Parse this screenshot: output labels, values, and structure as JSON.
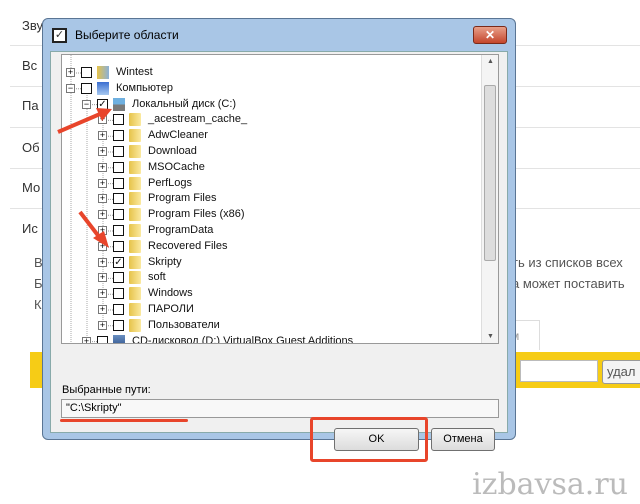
{
  "background": {
    "items": [
      "Зву",
      "Вс",
      "Па",
      "Об",
      "Мо",
      "Ис"
    ],
    "texts": [
      "В",
      "Б",
      "К",
      "ть из списков всех",
      "а может поставить"
    ],
    "tab_label": "м",
    "delete_button": "удал",
    "watermark": "izbavsa.ru"
  },
  "dialog": {
    "title": "Выберите области",
    "close_label": "✕",
    "tree": [
      {
        "label": "Wintest",
        "level": 0,
        "checked": false,
        "icon": "user-folder"
      },
      {
        "label": "Компьютер",
        "level": 0,
        "checked": false,
        "icon": "computer",
        "expanded": true
      },
      {
        "label": "Локальный диск (C:)",
        "level": 1,
        "checked": true,
        "icon": "drive",
        "expanded": true
      },
      {
        "label": "_acestream_cache_",
        "level": 2,
        "checked": false,
        "icon": "folder"
      },
      {
        "label": "AdwCleaner",
        "level": 2,
        "checked": false,
        "icon": "folder"
      },
      {
        "label": "Download",
        "level": 2,
        "checked": false,
        "icon": "folder"
      },
      {
        "label": "MSOCache",
        "level": 2,
        "checked": false,
        "icon": "folder"
      },
      {
        "label": "PerfLogs",
        "level": 2,
        "checked": false,
        "icon": "folder"
      },
      {
        "label": "Program Files",
        "level": 2,
        "checked": false,
        "icon": "folder"
      },
      {
        "label": "Program Files (x86)",
        "level": 2,
        "checked": false,
        "icon": "folder"
      },
      {
        "label": "ProgramData",
        "level": 2,
        "checked": false,
        "icon": "folder"
      },
      {
        "label": "Recovered Files",
        "level": 2,
        "checked": false,
        "icon": "folder"
      },
      {
        "label": "Skripty",
        "level": 2,
        "checked": true,
        "icon": "folder"
      },
      {
        "label": "soft",
        "level": 2,
        "checked": false,
        "icon": "folder"
      },
      {
        "label": "Windows",
        "level": 2,
        "checked": false,
        "icon": "folder"
      },
      {
        "label": "ПАРОЛИ",
        "level": 2,
        "checked": false,
        "icon": "folder"
      },
      {
        "label": "Пользователи",
        "level": 2,
        "checked": false,
        "icon": "folder"
      },
      {
        "label": "CD-дисковод (D:) VirtualBox Guest Additions",
        "level": 1,
        "checked": false,
        "icon": "cd-drive"
      }
    ],
    "paths_label": "Выбранные пути:",
    "paths_value": "\"C:\\Skripty\"",
    "ok_label": "OK",
    "cancel_label": "Отмена"
  },
  "colors": {
    "annotation": "#e8452b",
    "yellow_bar": "#f6cc16"
  }
}
